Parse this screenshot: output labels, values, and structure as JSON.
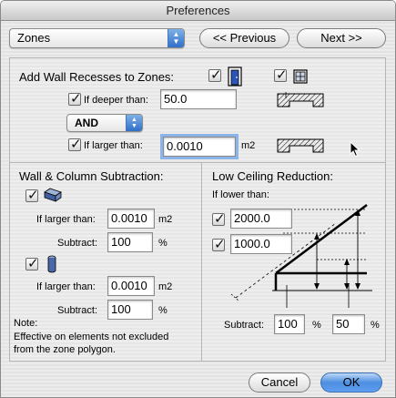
{
  "window": {
    "title": "Preferences"
  },
  "toolbar": {
    "category_selected": "Zones",
    "previous_label": "<< Previous",
    "next_label": "Next >>"
  },
  "wall_recesses": {
    "title": "Add Wall Recesses to Zones:",
    "deeper_label": "If deeper than:",
    "deeper_value": "50.0",
    "operator": "AND",
    "larger_label": "If larger than:",
    "larger_value": "0.0010",
    "larger_unit": "m2"
  },
  "wall_column": {
    "title": "Wall & Column Subtraction:",
    "wall_larger_label": "If larger than:",
    "wall_larger_value": "0.0010",
    "wall_larger_unit": "m2",
    "wall_subtract_label": "Subtract:",
    "wall_subtract_value": "100",
    "wall_subtract_unit": "%",
    "col_larger_label": "If larger than:",
    "col_larger_value": "0.0010",
    "col_larger_unit": "m2",
    "col_subtract_label": "Subtract:",
    "col_subtract_value": "100",
    "col_subtract_unit": "%",
    "note_label": "Note:",
    "note_text": "Effective on elements not excluded from the zone polygon."
  },
  "low_ceiling": {
    "title": "Low Ceiling Reduction:",
    "lower_label": "If lower than:",
    "height1_value": "2000.0",
    "height2_value": "1000.0",
    "subtract_label": "Subtract:",
    "subtract1_value": "100",
    "subtract1_unit": "%",
    "subtract2_value": "50",
    "subtract2_unit": "%"
  },
  "footer": {
    "cancel_label": "Cancel",
    "ok_label": "OK"
  },
  "colors": {
    "accent": "#4d8ee0",
    "focus_ring": "#8db4e8"
  }
}
